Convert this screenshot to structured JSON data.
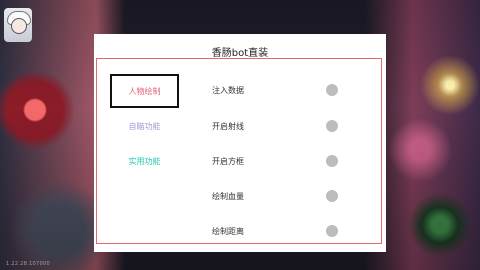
{
  "background": {
    "corner_text": "1.22.28.107000"
  },
  "menu": {
    "title": "香肠bot直装",
    "tabs": [
      {
        "label": "人物绘制",
        "color": "#e0607a",
        "active": true
      },
      {
        "label": "自瞄功能",
        "color": "#a99cd6",
        "active": false
      },
      {
        "label": "实用功能",
        "color": "#27c9b4",
        "active": false
      }
    ],
    "options": [
      {
        "label": "注入数据",
        "enabled": false
      },
      {
        "label": "开启射线",
        "enabled": false
      },
      {
        "label": "开启方框",
        "enabled": false
      },
      {
        "label": "绘制血量",
        "enabled": false
      },
      {
        "label": "绘制距离",
        "enabled": false
      }
    ],
    "colors": {
      "frame": "#e06a6a",
      "toggle_off": "#bdbdbd"
    }
  }
}
